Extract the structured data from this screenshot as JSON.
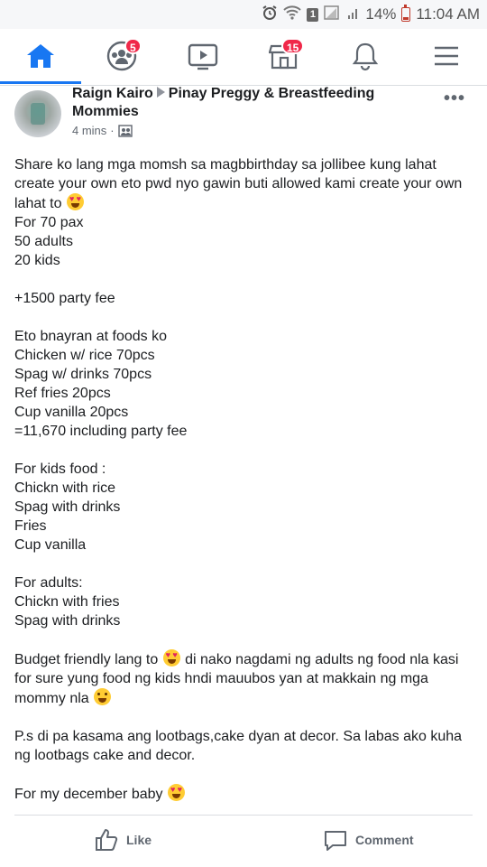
{
  "status_bar": {
    "sim_label": "1",
    "battery": "14%",
    "time": "11:04 AM"
  },
  "nav": {
    "items": [
      {
        "name": "home",
        "icon": "home-icon",
        "active": true
      },
      {
        "name": "groups",
        "icon": "groups-icon",
        "badge": "5"
      },
      {
        "name": "watch",
        "icon": "watch-icon"
      },
      {
        "name": "marketplace",
        "icon": "marketplace-icon",
        "badge": "15"
      },
      {
        "name": "notifications",
        "icon": "bell-icon"
      },
      {
        "name": "menu",
        "icon": "menu-icon"
      }
    ],
    "accent": "#1877f2",
    "badge_color": "#f02849"
  },
  "post": {
    "author": "Raign Kairo",
    "group": "Pinay Preggy & Breastfeeding Mommies",
    "time": "4 mins",
    "privacy_icon": "group-privacy-icon",
    "more_label": "•••",
    "body": {
      "intro": "Share ko lang mga momsh sa magbbirthday sa jollibee kung lahat create your own eto pwd nyo gawin buti allowed kami create your own lahat to",
      "pax_lines": [
        "For 70 pax",
        "50 adults",
        "20 kids"
      ],
      "party_fee": "+1500 party fee",
      "foods_lines": [
        "Eto bnayran at foods ko",
        "Chicken w/ rice 70pcs",
        "Spag w/ drinks 70pcs",
        "Ref fries 20pcs",
        "Cup vanilla 20pcs",
        "=11,670 including party fee"
      ],
      "kids_lines": [
        "For kids food :",
        "Chickn with rice",
        "Spag with drinks",
        "Fries",
        "Cup vanilla"
      ],
      "adults_lines": [
        "For adults:",
        "Chickn with fries",
        "Spag with drinks"
      ],
      "budget_a": "Budget friendly lang to",
      "budget_b": "di nako nagdami ng adults ng food nla kasi for sure yung food ng kids hndi mauubos yan at makkain ng mga mommy nla",
      "ps": "P.s di pa kasama ang lootbags,cake dyan at decor. Sa labas ako kuha ng lootbags cake and decor.",
      "closing": "For my december baby"
    },
    "actions": {
      "like": "Like",
      "comment": "Comment"
    }
  }
}
